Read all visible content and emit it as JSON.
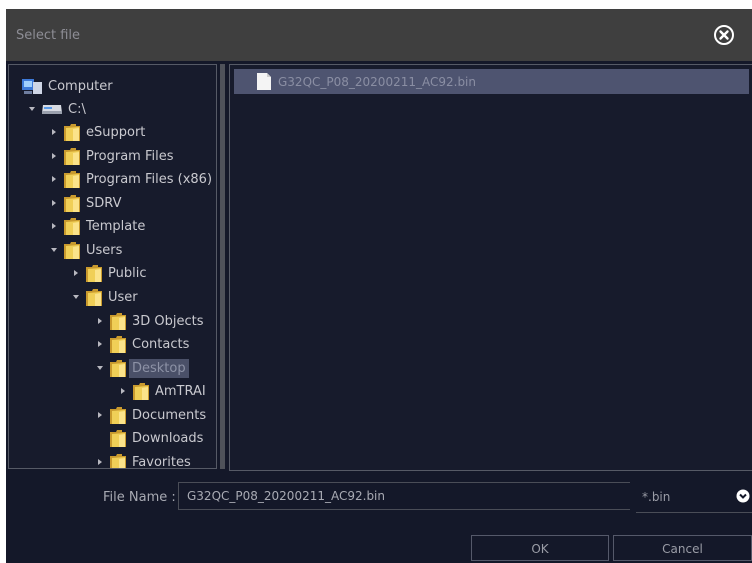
{
  "dialog": {
    "title": "Select file"
  },
  "tree": [
    {
      "label": "Computer",
      "icon": "computer-icon",
      "arrow": "none",
      "selected": false
    },
    {
      "label": "C:\\",
      "icon": "drive-icon",
      "arrow": "down",
      "selected": false
    },
    {
      "label": "eSupport",
      "icon": "folder-icon",
      "arrow": "right",
      "selected": false
    },
    {
      "label": "Program Files",
      "icon": "folder-icon",
      "arrow": "right",
      "selected": false
    },
    {
      "label": "Program Files (x86)",
      "icon": "folder-icon",
      "arrow": "right",
      "selected": false
    },
    {
      "label": "SDRV",
      "icon": "folder-icon",
      "arrow": "right",
      "selected": false
    },
    {
      "label": "Template",
      "icon": "folder-icon",
      "arrow": "right",
      "selected": false
    },
    {
      "label": "Users",
      "icon": "folder-icon",
      "arrow": "down",
      "selected": false
    },
    {
      "label": "Public",
      "icon": "folder-icon",
      "arrow": "right",
      "selected": false
    },
    {
      "label": "User",
      "icon": "folder-icon",
      "arrow": "down",
      "selected": false
    },
    {
      "label": "3D Objects",
      "icon": "folder-icon",
      "arrow": "right",
      "selected": false
    },
    {
      "label": "Contacts",
      "icon": "folder-icon",
      "arrow": "right",
      "selected": false
    },
    {
      "label": "Desktop",
      "icon": "folder-icon",
      "arrow": "down",
      "selected": true
    },
    {
      "label": "AmTRAI",
      "icon": "folder-icon",
      "arrow": "right",
      "selected": false
    },
    {
      "label": "Documents",
      "icon": "folder-icon",
      "arrow": "right",
      "selected": false
    },
    {
      "label": "Downloads",
      "icon": "folder-icon",
      "arrow": "none",
      "selected": false
    },
    {
      "label": "Favorites",
      "icon": "folder-icon",
      "arrow": "right",
      "selected": false
    }
  ],
  "files": [
    {
      "name": "G32QC_P08_20200211_AC92.bin",
      "icon": "file-icon",
      "selected": true
    }
  ],
  "footer": {
    "file_name_label": "File Name :",
    "file_name_value": "G32QC_P08_20200211_AC92.bin",
    "filter_value": "*.bin",
    "ok_label": "OK",
    "cancel_label": "Cancel"
  },
  "colors": {
    "background": "#141829",
    "titlebar": "#3f3f3f",
    "selection": "#4e5470",
    "folder": "#e8c64a"
  }
}
